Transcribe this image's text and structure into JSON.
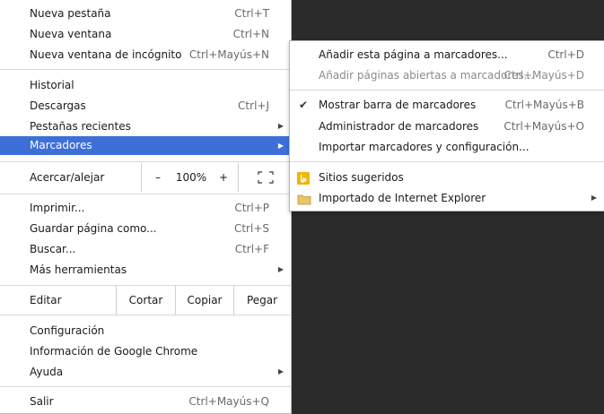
{
  "main_menu": {
    "items_top": [
      {
        "label": "Nueva pestaña",
        "shortcut": "Ctrl+T"
      },
      {
        "label": "Nueva ventana",
        "shortcut": "Ctrl+N"
      },
      {
        "label": "Nueva ventana de incógnito",
        "shortcut": "Ctrl+Mayús+N"
      }
    ],
    "items_history": [
      {
        "label": "Historial",
        "shortcut": ""
      },
      {
        "label": "Descargas",
        "shortcut": "Ctrl+J"
      },
      {
        "label": "Pestañas recientes",
        "shortcut": ""
      },
      {
        "label": "Marcadores",
        "shortcut": ""
      }
    ],
    "zoom": {
      "label": "Acercar/alejar",
      "minus": "–",
      "value": "100%",
      "plus": "+"
    },
    "items_tools": [
      {
        "label": "Imprimir...",
        "shortcut": "Ctrl+P"
      },
      {
        "label": "Guardar página como...",
        "shortcut": "Ctrl+S"
      },
      {
        "label": "Buscar...",
        "shortcut": "Ctrl+F"
      },
      {
        "label": "Más herramientas",
        "shortcut": ""
      }
    ],
    "edit": {
      "label": "Editar",
      "cut": "Cortar",
      "copy": "Copiar",
      "paste": "Pegar"
    },
    "items_settings": [
      {
        "label": "Configuración",
        "shortcut": ""
      },
      {
        "label": "Información de Google Chrome",
        "shortcut": ""
      },
      {
        "label": "Ayuda",
        "shortcut": ""
      }
    ],
    "exit": {
      "label": "Salir",
      "shortcut": "Ctrl+Mayús+Q"
    }
  },
  "bookmarks_submenu": {
    "items": [
      {
        "label": "Añadir esta página a marcadores...",
        "shortcut": "Ctrl+D"
      },
      {
        "label": "Añadir páginas abiertas a marcadores...",
        "shortcut": "Ctrl+Mayús+D"
      },
      {
        "label": "Mostrar barra de marcadores",
        "shortcut": "Ctrl+Mayús+B"
      },
      {
        "label": "Administrador de marcadores",
        "shortcut": "Ctrl+Mayús+O"
      },
      {
        "label": "Importar marcadores y configuración...",
        "shortcut": ""
      },
      {
        "label": "Sitios sugeridos",
        "shortcut": ""
      },
      {
        "label": "Importado de Internet Explorer",
        "shortcut": ""
      }
    ]
  },
  "colors": {
    "highlight": "#3d6fd8",
    "bing": "#f4b400",
    "folder": "#e8c46a"
  }
}
